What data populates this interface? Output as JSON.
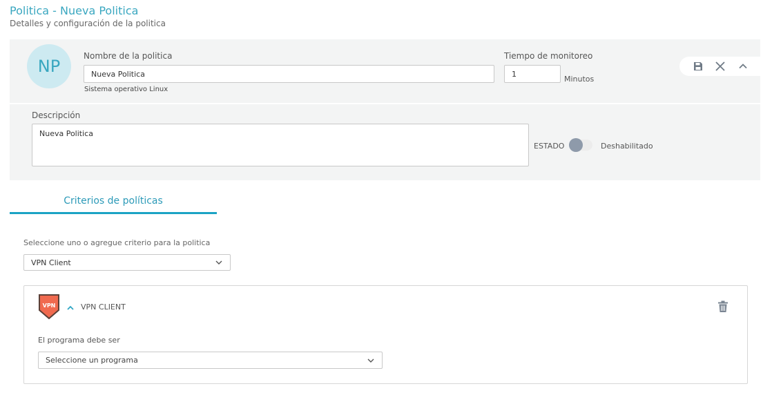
{
  "page": {
    "title": "Politica - Nueva Politica",
    "subtitle": "Detalles y configuración de la politica"
  },
  "header": {
    "avatar_initials": "NP",
    "name_label": "Nombre de la politica",
    "name_value": "Nueva Politica",
    "os_text": "Sistema operativo Linux",
    "time_label": "Tiempo de monitoreo",
    "time_value": "1",
    "time_unit": "Minutos",
    "actions": {
      "save_icon": "save-icon",
      "close_icon": "close-icon",
      "collapse_icon": "chevron-up-icon"
    }
  },
  "description": {
    "label": "Descripción",
    "value": "Nueva Politica",
    "estado_label": "ESTADO",
    "estado_value": "Deshabilitado"
  },
  "tabs": [
    {
      "label": "Criterios de políticas",
      "active": true
    }
  ],
  "criteria": {
    "select_label": "Seleccione uno o agregue criterio para la politica",
    "select_value": "VPN Client",
    "card": {
      "icon_text": "VPN",
      "title": "VPN CLIENT",
      "program_label": "El programa debe ser",
      "program_placeholder": "Seleccione un programa"
    }
  },
  "colors": {
    "accent": "#3aa7c0",
    "tab_underline": "#1ba3c4",
    "panel_bg": "#f3f4f4",
    "avatar_bg": "#cdeaf1",
    "toggle_knob": "#8e9aaa",
    "vpn_shield": "#f06a4f"
  }
}
